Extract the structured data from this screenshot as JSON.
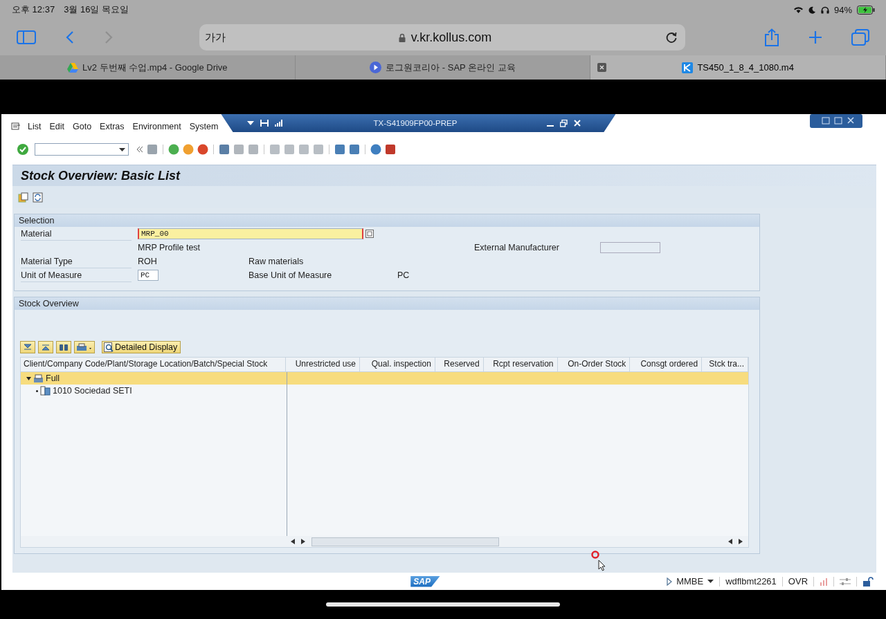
{
  "ios_status": {
    "time": "오후 12:37",
    "date": "3월 16일 목요일",
    "battery": "94%"
  },
  "browser": {
    "text_size": "가가",
    "url": "v.kr.kollus.com",
    "forward_disabled": true,
    "tabs": [
      {
        "title": "Lv2 두번째 수업.mp4 - Google Drive",
        "selected": false
      },
      {
        "title": "로그원코리아 - SAP 온라인 교육",
        "selected": false
      },
      {
        "title": "TS450_1_8_4_1080.m4",
        "selected": true
      }
    ]
  },
  "sap": {
    "menu": [
      "List",
      "Edit",
      "Goto",
      "Extras",
      "Environment",
      "System"
    ],
    "window_title": "TX-S41909FP00-PREP",
    "screen_title": "Stock Overview: Basic List",
    "selection": {
      "title": "Selection",
      "material_label": "Material",
      "material_value": "MRP_00",
      "material_desc": "MRP Profile test",
      "ext_manufacturer_label": "External Manufacturer",
      "material_type_label": "Material Type",
      "material_type": "ROH",
      "material_type_desc": "Raw materials",
      "uom_label": "Unit of Measure",
      "uom_value": "PC",
      "base_uom_label": "Base Unit of Measure",
      "base_uom": "PC"
    },
    "stock": {
      "title": "Stock Overview",
      "detail_button": "Detailed Display",
      "columns": [
        "Client/Company Code/Plant/Storage Location/Batch/Special Stock",
        "Unrestricted use",
        "Qual. inspection",
        "Reserved",
        "Rcpt reservation",
        "On-Order Stock",
        "Consgt ordered",
        "Stck tra..."
      ],
      "tree": [
        {
          "label": "Full",
          "selected": true,
          "expanded": true,
          "children": [
            {
              "label": "1010 Sociedad SETI",
              "selected": false
            }
          ]
        }
      ]
    },
    "status": {
      "logo": "SAP",
      "transaction": "MMBE",
      "server": "wdflbmt2261",
      "mode": "OVR"
    }
  }
}
